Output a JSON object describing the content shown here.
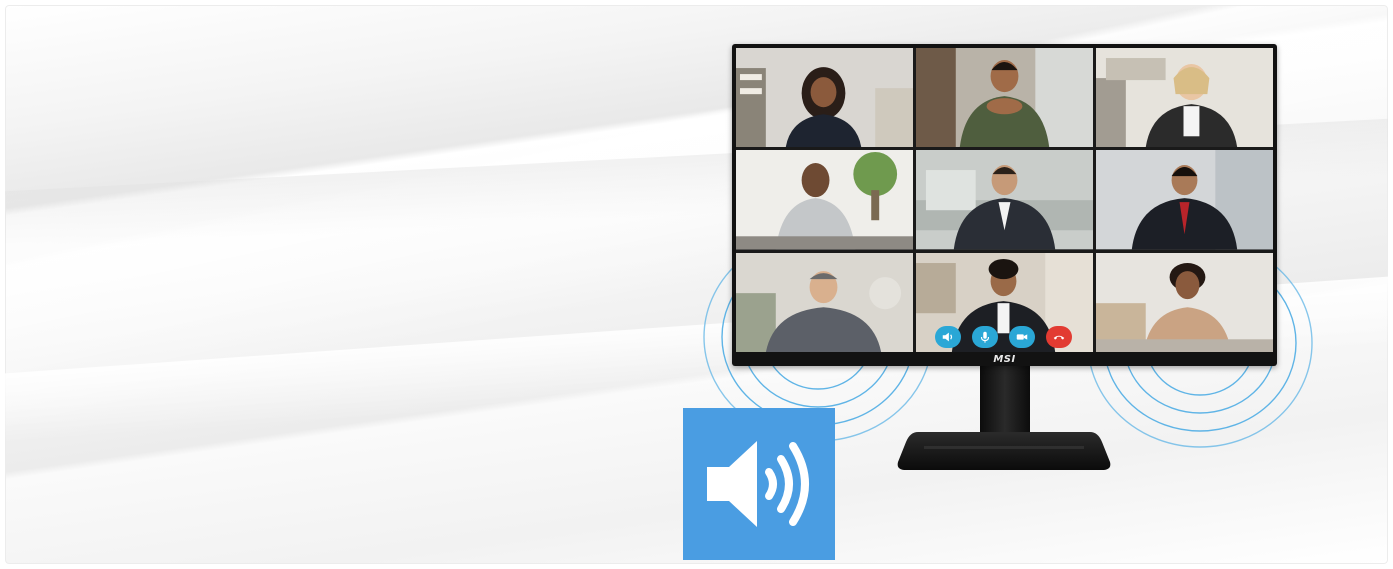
{
  "monitor": {
    "brand_text": "MSI"
  },
  "call_controls": [
    {
      "name": "speaker-button",
      "icon": "speaker-icon",
      "color": "#2aa7d6"
    },
    {
      "name": "microphone-button",
      "icon": "microphone-icon",
      "color": "#2aa7d6"
    },
    {
      "name": "camera-button",
      "icon": "video-camera-icon",
      "color": "#2aa7d6"
    },
    {
      "name": "end-call-button",
      "icon": "phone-hangup-icon",
      "color": "#e23b32"
    }
  ],
  "speaker_badge": {
    "icon": "speaker-volume-icon",
    "color": "#4a9de2"
  },
  "colors": {
    "ripple": "#5fb4e6",
    "monitor_bezel": "#121212"
  }
}
